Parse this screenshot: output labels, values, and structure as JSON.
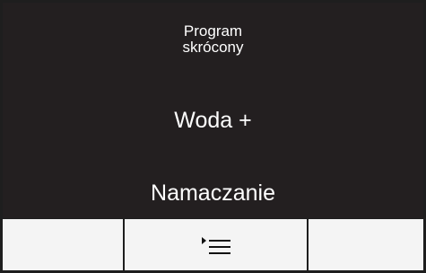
{
  "screen": {
    "title_lines": [
      "Program",
      "skrócony"
    ],
    "options": [
      "Woda +",
      "Namaczanie"
    ]
  },
  "button_bar": {
    "left_label": "",
    "center_icon": "menu-list-icon",
    "right_label": ""
  },
  "colors": {
    "screen_background": "#231f20",
    "text": "#ffffff",
    "button_background": "#f4f4f4",
    "frame": "#1e1e1e"
  }
}
